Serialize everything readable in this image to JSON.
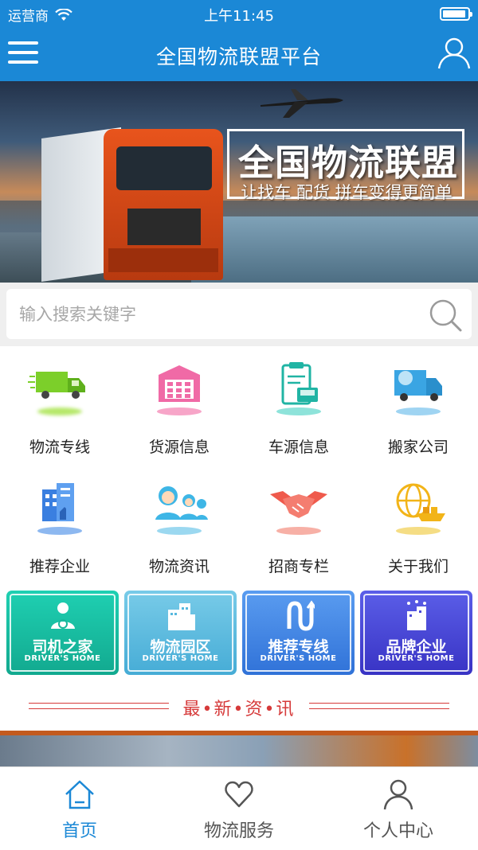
{
  "status_bar": {
    "carrier": "运营商",
    "time": "上午11:45"
  },
  "header": {
    "title": "全国物流联盟平台",
    "menu_icon": "hamburger-icon",
    "user_icon": "user-icon"
  },
  "banner": {
    "title": "全国物流联盟",
    "subtitle": "让找车 配货 拼车变得更简单"
  },
  "search": {
    "placeholder": "输入搜索关键字"
  },
  "grid": [
    {
      "label": "物流专线",
      "icon": "delivery-truck-icon"
    },
    {
      "label": "货源信息",
      "icon": "warehouse-icon"
    },
    {
      "label": "车源信息",
      "icon": "vehicle-clipboard-icon"
    },
    {
      "label": "搬家公司",
      "icon": "moving-truck-icon"
    },
    {
      "label": "推荐企业",
      "icon": "building-thumbs-up-icon"
    },
    {
      "label": "物流资讯",
      "icon": "customer-service-icon"
    },
    {
      "label": "招商专栏",
      "icon": "handshake-icon"
    },
    {
      "label": "关于我们",
      "icon": "globe-ship-icon"
    }
  ],
  "cards": [
    {
      "title": "司机之家",
      "subtitle": "DRIVER'S HOME",
      "icon": "driver-icon",
      "color": "#17b9a4"
    },
    {
      "title": "物流园区",
      "subtitle": "DRIVER'S HOME",
      "icon": "buildings-icon",
      "color": "#56b8de"
    },
    {
      "title": "推荐专线",
      "subtitle": "DRIVER'S HOME",
      "icon": "route-icon",
      "color": "#3e83e0"
    },
    {
      "title": "品牌企业",
      "subtitle": "DRIVER'S HOME",
      "icon": "star-building-icon",
      "color": "#4a49d6"
    }
  ],
  "news": {
    "title": "最•新•资•讯"
  },
  "tabbar": [
    {
      "label": "首页",
      "icon": "home-icon",
      "active": true
    },
    {
      "label": "物流服务",
      "icon": "heart-icon",
      "active": false
    },
    {
      "label": "个人中心",
      "icon": "person-icon",
      "active": false
    }
  ],
  "colors": {
    "brand": "#1b88d6",
    "news_red": "#d63a3a"
  }
}
